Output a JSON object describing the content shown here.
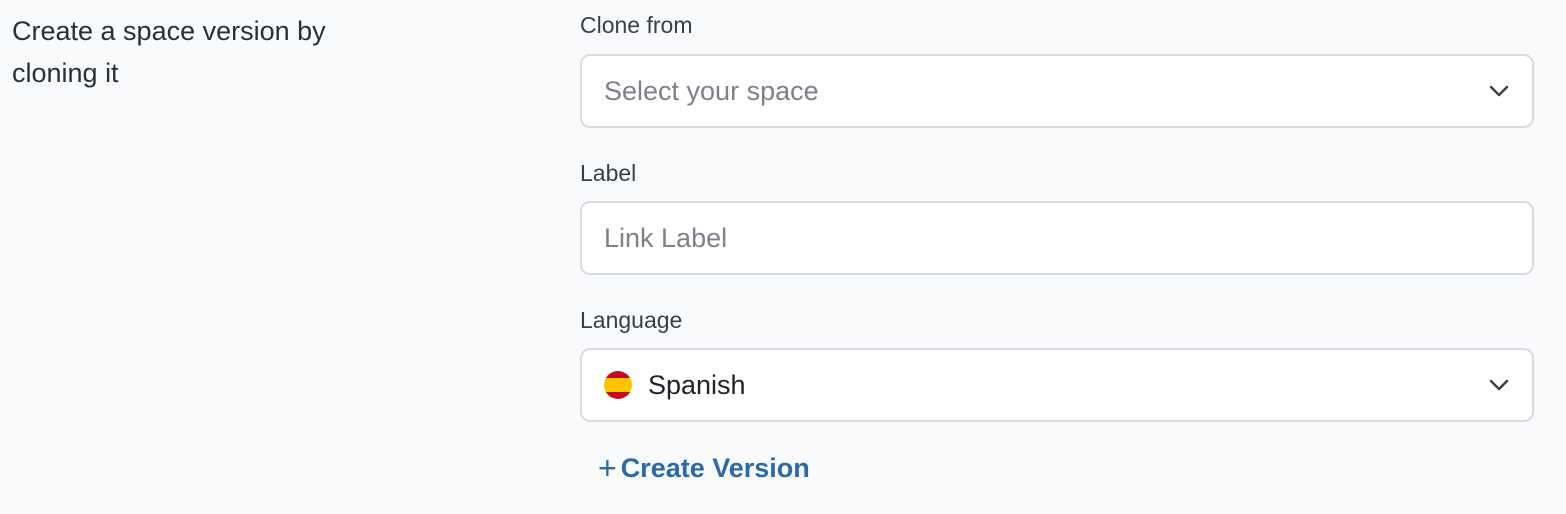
{
  "section": {
    "description": "Create a space version by cloning it"
  },
  "form": {
    "clone_from": {
      "label": "Clone from",
      "placeholder": "Select your space",
      "icon": "chevron-down-icon"
    },
    "label_field": {
      "label": "Label",
      "placeholder": "Link Label",
      "value": ""
    },
    "language": {
      "label": "Language",
      "value": "Spanish",
      "flag_icon": "spain-flag-icon",
      "icon": "chevron-down-icon"
    },
    "create_action": {
      "icon_glyph": "+",
      "label": "Create Version",
      "color": "#2a6aa8"
    }
  }
}
